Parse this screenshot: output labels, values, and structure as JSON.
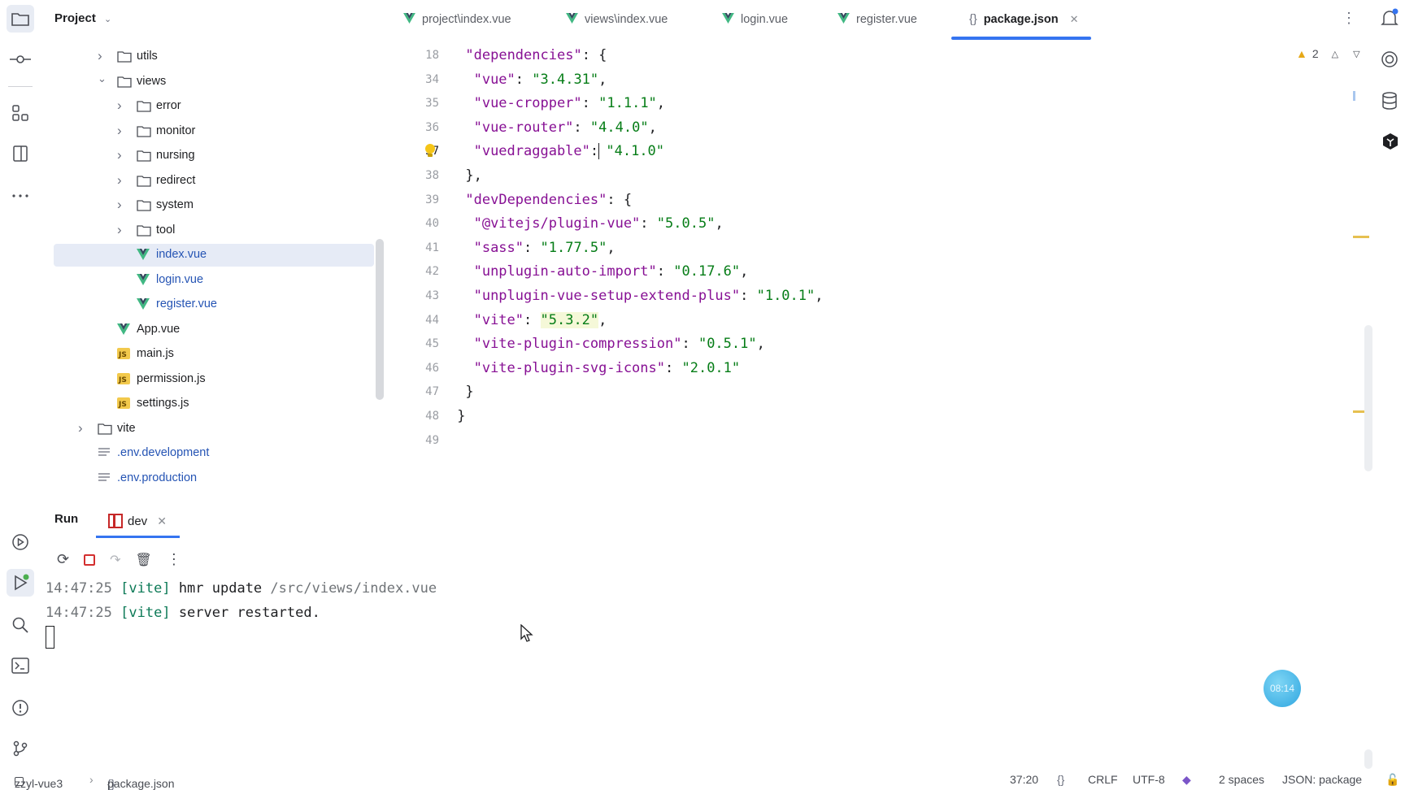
{
  "project": {
    "title": "Project"
  },
  "tabs": [
    {
      "label": "project\\index.vue",
      "type": "vue"
    },
    {
      "label": "views\\index.vue",
      "type": "vue"
    },
    {
      "label": "login.vue",
      "type": "vue"
    },
    {
      "label": "register.vue",
      "type": "vue"
    },
    {
      "label": "package.json",
      "type": "json",
      "active": true
    }
  ],
  "tree": [
    {
      "label": "utils",
      "kind": "folder",
      "expanded": false
    },
    {
      "label": "views",
      "kind": "folder",
      "expanded": true
    },
    {
      "label": "error",
      "kind": "folder",
      "expanded": false
    },
    {
      "label": "monitor",
      "kind": "folder",
      "expanded": false
    },
    {
      "label": "nursing",
      "kind": "folder",
      "expanded": false
    },
    {
      "label": "redirect",
      "kind": "folder",
      "expanded": false
    },
    {
      "label": "system",
      "kind": "folder",
      "expanded": false
    },
    {
      "label": "tool",
      "kind": "folder",
      "expanded": false
    },
    {
      "label": "index.vue",
      "kind": "vue",
      "selected": true
    },
    {
      "label": "login.vue",
      "kind": "vue"
    },
    {
      "label": "register.vue",
      "kind": "vue"
    },
    {
      "label": "App.vue",
      "kind": "vue"
    },
    {
      "label": "main.js",
      "kind": "js"
    },
    {
      "label": "permission.js",
      "kind": "js"
    },
    {
      "label": "settings.js",
      "kind": "js"
    },
    {
      "label": "vite",
      "kind": "folder",
      "expanded": false
    },
    {
      "label": ".env.development",
      "kind": "text"
    },
    {
      "label": ".env.production",
      "kind": "text"
    }
  ],
  "editor": {
    "warnings": "2",
    "lines": [
      {
        "n": "18",
        "key": "\"dependencies\"",
        "rest": ": {"
      },
      {
        "n": "34",
        "key": "\"vue\"",
        "val": "\"3.4.31\"",
        "end": ","
      },
      {
        "n": "35",
        "key": "\"vue-cropper\"",
        "val": "\"1.1.1\"",
        "end": ","
      },
      {
        "n": "36",
        "key": "\"vue-router\"",
        "val": "\"4.4.0\"",
        "end": ","
      },
      {
        "n": "37",
        "key": "\"vuedraggable\"",
        "val": "\"4.1.0\"",
        "end": ""
      },
      {
        "n": "38",
        "rest": "},"
      },
      {
        "n": "39",
        "key": "\"devDependencies\"",
        "rest": ": {"
      },
      {
        "n": "40",
        "key": "\"@vitejs/plugin-vue\"",
        "val": "\"5.0.5\"",
        "end": ","
      },
      {
        "n": "41",
        "key": "\"sass\"",
        "val": "\"1.77.5\"",
        "end": ","
      },
      {
        "n": "42",
        "key": "\"unplugin-auto-import\"",
        "val": "\"0.17.6\"",
        "end": ","
      },
      {
        "n": "43",
        "key": "\"unplugin-vue-setup-extend-plus\"",
        "val": "\"1.0.1\"",
        "end": ","
      },
      {
        "n": "44",
        "key": "\"vite\"",
        "val": "\"5.3.2\"",
        "end": ","
      },
      {
        "n": "45",
        "key": "\"vite-plugin-compression\"",
        "val": "\"0.5.1\"",
        "end": ","
      },
      {
        "n": "46",
        "key": "\"vite-plugin-svg-icons\"",
        "val": "\"2.0.1\"",
        "end": ""
      },
      {
        "n": "47",
        "rest": "}"
      },
      {
        "n": "48",
        "rest": "}"
      },
      {
        "n": "49",
        "rest": ""
      }
    ]
  },
  "run": {
    "title": "Run",
    "tab": "dev",
    "console": [
      {
        "time": "14:47:25",
        "tag": "[vite]",
        "msg": "hmr update",
        "path": "/src/views/index.vue"
      },
      {
        "time": "14:47:25",
        "tag": "[vite]",
        "msg": "server restarted.",
        "path": ""
      }
    ]
  },
  "timer": "08:14",
  "status": {
    "project": "zzyl-vue3",
    "file": "package.json",
    "position": "37:20",
    "line_ending": "CRLF",
    "encoding": "UTF-8",
    "indent": "2 spaces",
    "schema": "JSON: package"
  }
}
